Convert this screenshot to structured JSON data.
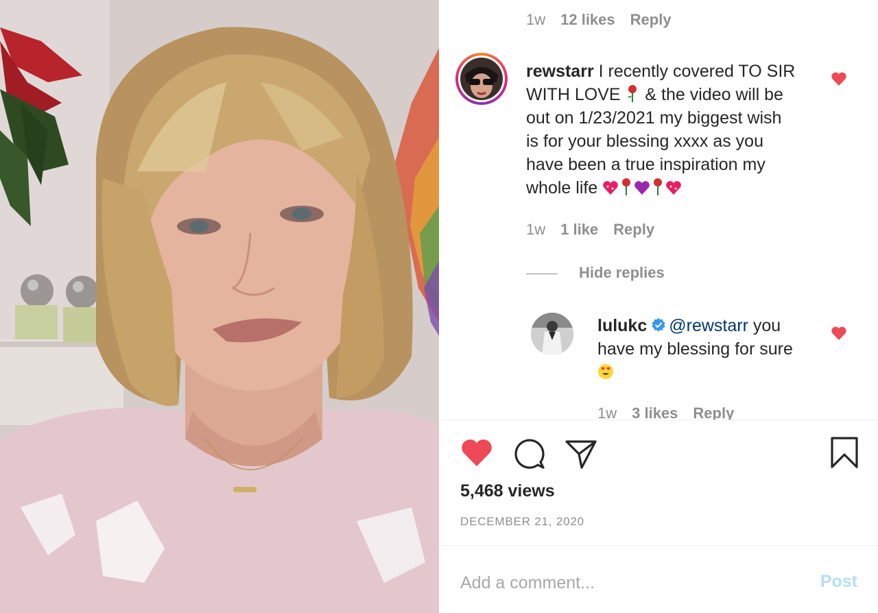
{
  "media": {
    "alt": "video thumbnail"
  },
  "top_meta": {
    "time": "1w",
    "likes": "12 likes",
    "reply": "Reply"
  },
  "comment1": {
    "username": "rewstarr",
    "text_lines": [
      "I recently covered TO SIR",
      "WITH LOVE",
      "& the video will be",
      "out on 1/23/2021 my biggest wish",
      "is for your blessing xxxx as you",
      "have been a true inspiration my",
      "whole life"
    ],
    "time": "1w",
    "likes": "1 like",
    "reply": "Reply"
  },
  "hide_replies": "Hide replies",
  "reply1": {
    "username": "lulukc",
    "mention": "@rewstarr",
    "text_line1": " you",
    "text_line2": "have my blessing for sure",
    "time": "1w",
    "likes": "3 likes",
    "reply": "Reply"
  },
  "post": {
    "views": "5,468 views",
    "date": "DECEMBER 21, 2020"
  },
  "comment_box": {
    "placeholder": "Add a comment...",
    "post_label": "Post"
  },
  "colors": {
    "heart": "#ed4956",
    "link": "#00376b",
    "muted": "#8e8e8e",
    "post_disabled": "#b2dffc",
    "verified": "#3897f0"
  },
  "icons": [
    "heart-icon",
    "comment-icon",
    "share-icon",
    "bookmark-icon",
    "verified-icon"
  ]
}
